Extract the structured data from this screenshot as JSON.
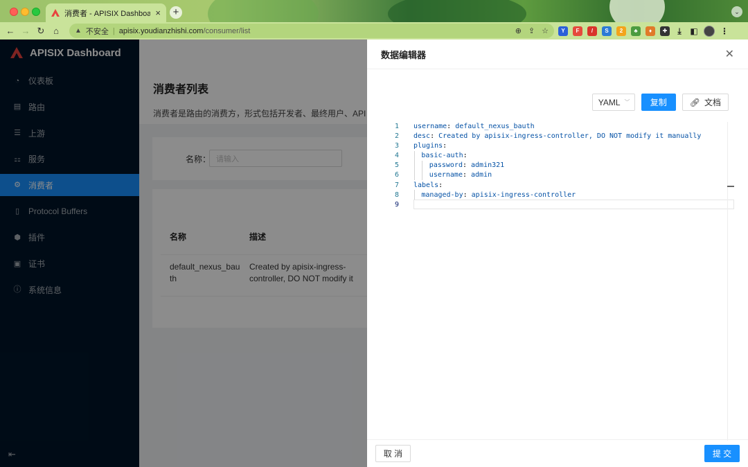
{
  "browser": {
    "tab_title": "消费者 - APISIX Dashboard",
    "tab_close": "×",
    "new_tab": "+",
    "insecure_label": "不安全",
    "url_host": "apisix.youdianzhishi.com",
    "url_path": "/consumer/list"
  },
  "sidebar": {
    "brand": "APISIX Dashboard",
    "items": [
      {
        "label": "仪表板",
        "icon": "dashboard-icon",
        "glyph": "◔"
      },
      {
        "label": "路由",
        "icon": "route-icon",
        "glyph": "▤"
      },
      {
        "label": "上游",
        "icon": "upstream-icon",
        "glyph": "☰"
      },
      {
        "label": "服务",
        "icon": "service-icon",
        "glyph": "⚏"
      },
      {
        "label": "消费者",
        "icon": "consumer-icon",
        "glyph": "⚙"
      },
      {
        "label": "Protocol Buffers",
        "icon": "file-icon",
        "glyph": "▯"
      },
      {
        "label": "插件",
        "icon": "plugin-icon",
        "glyph": "⬢"
      },
      {
        "label": "证书",
        "icon": "certificate-icon",
        "glyph": "▣"
      },
      {
        "label": "系统信息",
        "icon": "info-icon",
        "glyph": "ⓘ"
      }
    ],
    "active_index": 4
  },
  "page": {
    "title": "消费者列表",
    "description": "消费者是路由的消费方，形式包括开发者、最终用户、API 调用等。创建消费者时，需绑定至少一个认证类插件。",
    "search": {
      "label": "名称：",
      "placeholder": "请输入"
    },
    "table": {
      "headers": [
        "名称",
        "描述"
      ],
      "rows": [
        {
          "name": "default_nexus_bauth",
          "desc": "Created by apisix-ingress-controller, DO NOT modify it manually"
        }
      ]
    }
  },
  "drawer": {
    "title": "数据编辑器",
    "format_select": "YAML",
    "copy_button": "复制",
    "docs_button": "文档",
    "cancel_button": "取 消",
    "submit_button": "提 交",
    "editor_lines": [
      {
        "n": "1",
        "indent": 0,
        "key": "username",
        "value": "default_nexus_bauth"
      },
      {
        "n": "2",
        "indent": 0,
        "key": "desc",
        "value": "Created by apisix-ingress-controller, DO NOT modify it manually"
      },
      {
        "n": "3",
        "indent": 0,
        "key": "plugins",
        "value": ""
      },
      {
        "n": "4",
        "indent": 1,
        "key": "basic-auth",
        "value": ""
      },
      {
        "n": "5",
        "indent": 2,
        "key": "password",
        "value": "admin321"
      },
      {
        "n": "6",
        "indent": 2,
        "key": "username",
        "value": "admin"
      },
      {
        "n": "7",
        "indent": 0,
        "key": "labels",
        "value": ""
      },
      {
        "n": "8",
        "indent": 1,
        "key": "managed-by",
        "value": "apisix-ingress-controller"
      },
      {
        "n": "9",
        "indent": 0,
        "key": "",
        "value": ""
      }
    ]
  }
}
